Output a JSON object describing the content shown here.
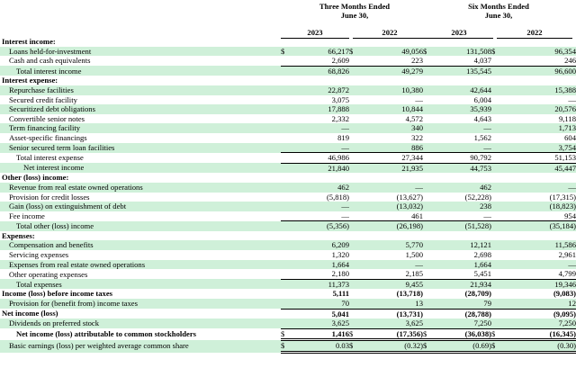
{
  "header": {
    "group1_line1": "Three Months Ended",
    "group1_line2": "June 30,",
    "group2_line1": "Six Months Ended",
    "group2_line2": "June 30,",
    "years": [
      "2023",
      "2022",
      "2023",
      "2022"
    ]
  },
  "rows": [
    {
      "label": "Interest income:",
      "style": "section"
    },
    {
      "label": "Loans held-for-investment",
      "indent": 1,
      "cur": [
        "$",
        "$",
        "$",
        "$"
      ],
      "values": [
        "66,217",
        "49,056",
        "131,508",
        "96,354"
      ]
    },
    {
      "label": "Cash and cash equivalents",
      "indent": 1,
      "values": [
        "2,609",
        "223",
        "4,037",
        "246"
      ]
    },
    {
      "label": "Total interest income",
      "indent": 2,
      "values": [
        "68,826",
        "49,279",
        "135,545",
        "96,600"
      ],
      "sub": true
    },
    {
      "label": "Interest expense:",
      "style": "section"
    },
    {
      "label": "Repurchase facilities",
      "indent": 1,
      "values": [
        "22,872",
        "10,380",
        "42,644",
        "15,388"
      ]
    },
    {
      "label": "Secured credit facility",
      "indent": 1,
      "values": [
        "3,075",
        "—",
        "6,004",
        "—"
      ]
    },
    {
      "label": "Securitized debt obligations",
      "indent": 1,
      "values": [
        "17,888",
        "10,844",
        "35,939",
        "20,576"
      ]
    },
    {
      "label": "Convertible senior notes",
      "indent": 1,
      "values": [
        "2,332",
        "4,572",
        "4,643",
        "9,118"
      ]
    },
    {
      "label": "Term financing facility",
      "indent": 1,
      "values": [
        "—",
        "340",
        "—",
        "1,713"
      ]
    },
    {
      "label": "Asset-specific financings",
      "indent": 1,
      "values": [
        "819",
        "322",
        "1,562",
        "604"
      ]
    },
    {
      "label": "Senior secured term loan facilities",
      "indent": 1,
      "values": [
        "—",
        "886",
        "—",
        "3,754"
      ]
    },
    {
      "label": "Total interest expense",
      "indent": 2,
      "values": [
        "46,986",
        "27,344",
        "90,792",
        "51,153"
      ],
      "sub": true
    },
    {
      "label": "Net interest income",
      "indent": 3,
      "values": [
        "21,840",
        "21,935",
        "44,753",
        "45,447"
      ],
      "sub": true
    },
    {
      "label": "Other (loss) income:",
      "style": "section"
    },
    {
      "label": "Revenue from real estate owned operations",
      "indent": 1,
      "values": [
        "462",
        "—",
        "462",
        "—"
      ]
    },
    {
      "label": "Provision for credit losses",
      "indent": 1,
      "values": [
        "(5,818)",
        "(13,627)",
        "(52,228)",
        "(17,315)"
      ]
    },
    {
      "label": "Gain (loss) on extinguishment of debt",
      "indent": 1,
      "values": [
        "—",
        "(13,032)",
        "238",
        "(18,823)"
      ]
    },
    {
      "label": "Fee income",
      "indent": 1,
      "values": [
        "—",
        "461",
        "—",
        "954"
      ]
    },
    {
      "label": "Total other (loss) income",
      "indent": 2,
      "values": [
        "(5,356)",
        "(26,198)",
        "(51,528)",
        "(35,184)"
      ],
      "sub": true
    },
    {
      "label": "Expenses:",
      "style": "section"
    },
    {
      "label": "Compensation and benefits",
      "indent": 1,
      "values": [
        "6,209",
        "5,770",
        "12,121",
        "11,586"
      ]
    },
    {
      "label": "Servicing expenses",
      "indent": 1,
      "values": [
        "1,320",
        "1,500",
        "2,698",
        "2,961"
      ]
    },
    {
      "label": "Expenses from real estate owned operations",
      "indent": 1,
      "values": [
        "1,664",
        "—",
        "1,664",
        "—"
      ]
    },
    {
      "label": "Other operating expenses",
      "indent": 1,
      "values": [
        "2,180",
        "2,185",
        "5,451",
        "4,799"
      ]
    },
    {
      "label": "Total expenses",
      "indent": 2,
      "values": [
        "11,373",
        "9,455",
        "21,934",
        "19,346"
      ],
      "sub": true
    },
    {
      "label": "Income (loss) before income taxes",
      "style": "section",
      "values": [
        "5,111",
        "(13,718)",
        "(28,709)",
        "(9,083)"
      ]
    },
    {
      "label": "Provision for (benefit from) income taxes",
      "indent": 1,
      "values": [
        "70",
        "13",
        "79",
        "12"
      ]
    },
    {
      "label": "Net income (loss)",
      "style": "section",
      "values": [
        "5,041",
        "(13,731)",
        "(28,788)",
        "(9,095)"
      ],
      "sub": true
    },
    {
      "label": "Dividends on preferred stock",
      "indent": 1,
      "values": [
        "3,625",
        "3,625",
        "7,250",
        "7,250"
      ]
    },
    {
      "label": "Net income (loss) attributable to common stockholders",
      "indent": 2,
      "bold": true,
      "cur": [
        "$",
        "$",
        "$",
        "$"
      ],
      "values": [
        "1,416",
        "(17,356)",
        "(36,038)",
        "(16,345)"
      ],
      "sub": true,
      "dbl": true
    },
    {
      "label": "Basic earnings (loss) per weighted average common share",
      "indent": 1,
      "cur": [
        "$",
        "$",
        "$",
        "$"
      ],
      "values": [
        "0.03",
        "(0.32)",
        "(0.69)",
        "(0.30)"
      ],
      "dbl": true
    }
  ]
}
